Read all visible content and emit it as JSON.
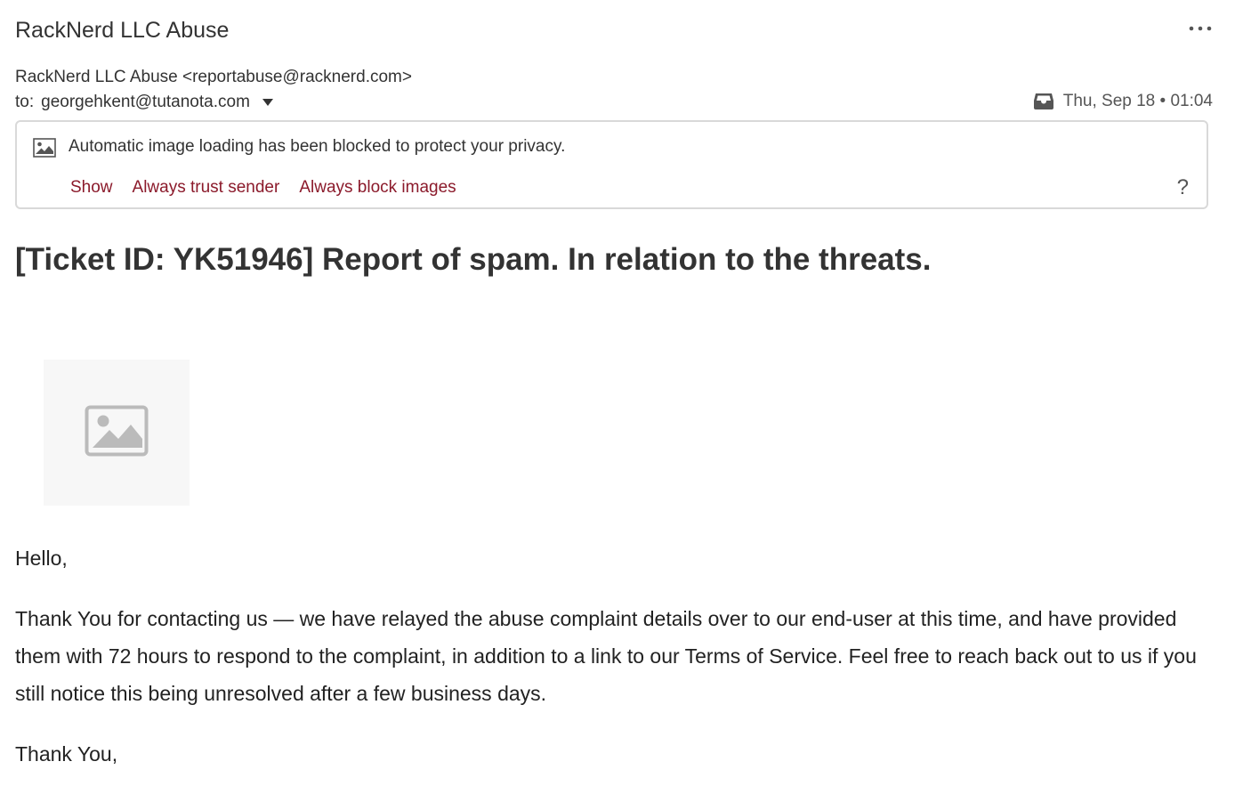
{
  "header": {
    "sender_title": "RackNerd LLC Abuse",
    "from": "RackNerd LLC Abuse <reportabuse@racknerd.com>",
    "to_label": "to:",
    "to_address": "georgehkent@tutanota.com",
    "date": "Thu, Sep 18 • 01:04",
    "more_icon": "more-horizontal-icon",
    "folder_icon": "inbox-icon"
  },
  "image_banner": {
    "message": "Automatic image loading has been blocked to protect your privacy.",
    "show_label": "Show",
    "trust_label": "Always trust sender",
    "block_label": "Always block images",
    "help_label": "?",
    "link_color": "#8b1a2b"
  },
  "email": {
    "subject": "[Ticket ID: YK51946] Report of spam. In relation to the threats.",
    "greeting": "Hello,",
    "paragraph": "Thank You for contacting us — we have relayed the abuse complaint details over to our end-user at this time, and have provided them with 72 hours to respond to the complaint, in addition to a link to our Terms of Service. Feel free to reach back out to us if you still notice this being unresolved after a few business days.",
    "closing": "Thank You,"
  }
}
